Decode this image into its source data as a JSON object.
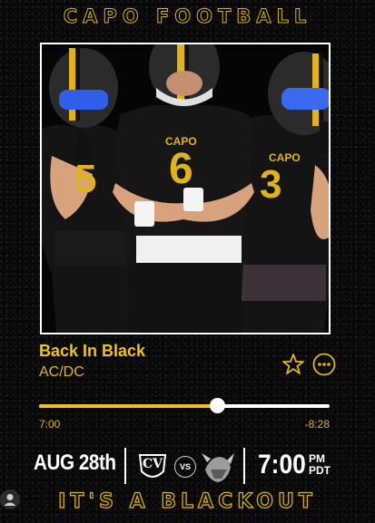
{
  "header": {
    "title": "CAPO FOOTBALL"
  },
  "artwork": {
    "jersey_numbers": [
      "5",
      "6",
      "3"
    ],
    "jersey_text": "CAPO",
    "helmet_color": "#2b2b2b",
    "accent_color": "#e2b21e"
  },
  "player": {
    "song_title": "Back In Black",
    "artist": "AC/DC",
    "elapsed": "7:00",
    "remaining": "-8:28",
    "progress": 0.615,
    "favorite_icon": "star-icon",
    "more_icon": "more-options-icon"
  },
  "event": {
    "date": "AUG 28th",
    "home_logo": "CV",
    "vs_text": "VS",
    "away_logo": "viking-logo",
    "time": "7:00",
    "ampm": "PM",
    "tz": "PDT"
  },
  "footer": {
    "tagline": "IT'S A BLACKOUT",
    "avatar_icon": "user-avatar-icon"
  },
  "colors": {
    "gold": "#e2b21e",
    "bright_gold": "#f2c21c",
    "background": "#080808",
    "white": "#ffffff"
  }
}
